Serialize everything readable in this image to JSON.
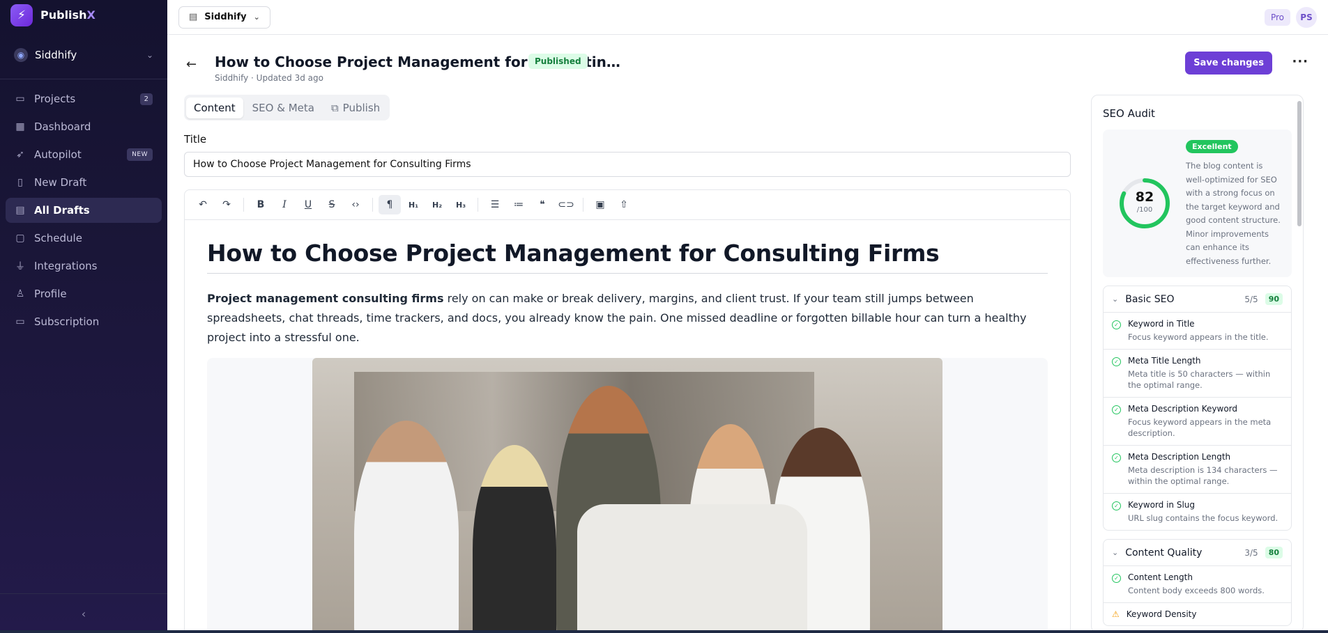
{
  "brand": {
    "name": "Publish",
    "accent": "X",
    "accent_color": "#a78bfa"
  },
  "workspace": {
    "name": "Siddhify"
  },
  "sidebar": {
    "items": [
      {
        "label": "Projects",
        "badge": "2"
      },
      {
        "label": "Dashboard"
      },
      {
        "label": "Autopilot",
        "badge": "NEW"
      },
      {
        "label": "New Draft"
      },
      {
        "label": "All Drafts"
      },
      {
        "label": "Schedule"
      },
      {
        "label": "Integrations"
      },
      {
        "label": "Profile"
      },
      {
        "label": "Subscription"
      }
    ],
    "collapse_icon": "chevron-left-icon"
  },
  "topbar": {
    "project": "Siddhify",
    "plan": "Pro",
    "user_initials": "PS"
  },
  "doc": {
    "title": "How to Choose Project Management for Consultin…",
    "status": "Published",
    "subtitle": "Siddhify · Updated 3d ago",
    "save_label": "Save changes"
  },
  "tabs": [
    {
      "label": "Content"
    },
    {
      "label": "SEO & Meta"
    },
    {
      "label": "Publish"
    }
  ],
  "title_field": {
    "label": "Title",
    "value": "How to Choose Project Management for Consulting Firms"
  },
  "editor": {
    "heading": "How to Choose Project Management for Consulting Firms",
    "para_bold": "Project management consulting firms",
    "para_rest": " rely on can make or break delivery, margins, and client trust. If your team still jumps between spreadsheets, chat threads, time trackers, and docs, you already know the pain. One missed deadline or forgotten billable hour can turn a healthy project into a stressful one."
  },
  "seo": {
    "title": "SEO Audit",
    "score": "82",
    "score_den": "/100",
    "score_fraction": 0.82,
    "rating": "Excellent",
    "verdict": "The blog content is well-optimized for SEO with a strong focus on the target keyword and good content structure. Minor improvements can enhance its effectiveness further.",
    "sections": [
      {
        "name": "Basic SEO",
        "count": "5/5",
        "points": "90",
        "checks": [
          {
            "title": "Keyword in Title",
            "desc": "Focus keyword appears in the title."
          },
          {
            "title": "Meta Title Length",
            "desc": "Meta title is 50 characters — within the optimal range."
          },
          {
            "title": "Meta Description Keyword",
            "desc": "Focus keyword appears in the meta description."
          },
          {
            "title": "Meta Description Length",
            "desc": "Meta description is 134 characters — within the optimal range."
          },
          {
            "title": "Keyword in Slug",
            "desc": "URL slug contains the focus keyword."
          }
        ]
      },
      {
        "name": "Content Quality",
        "count": "3/5",
        "points": "80",
        "checks": [
          {
            "title": "Content Length",
            "desc": "Content body exceeds 800 words."
          },
          {
            "title": "Keyword Density",
            "desc": ""
          }
        ]
      }
    ]
  }
}
